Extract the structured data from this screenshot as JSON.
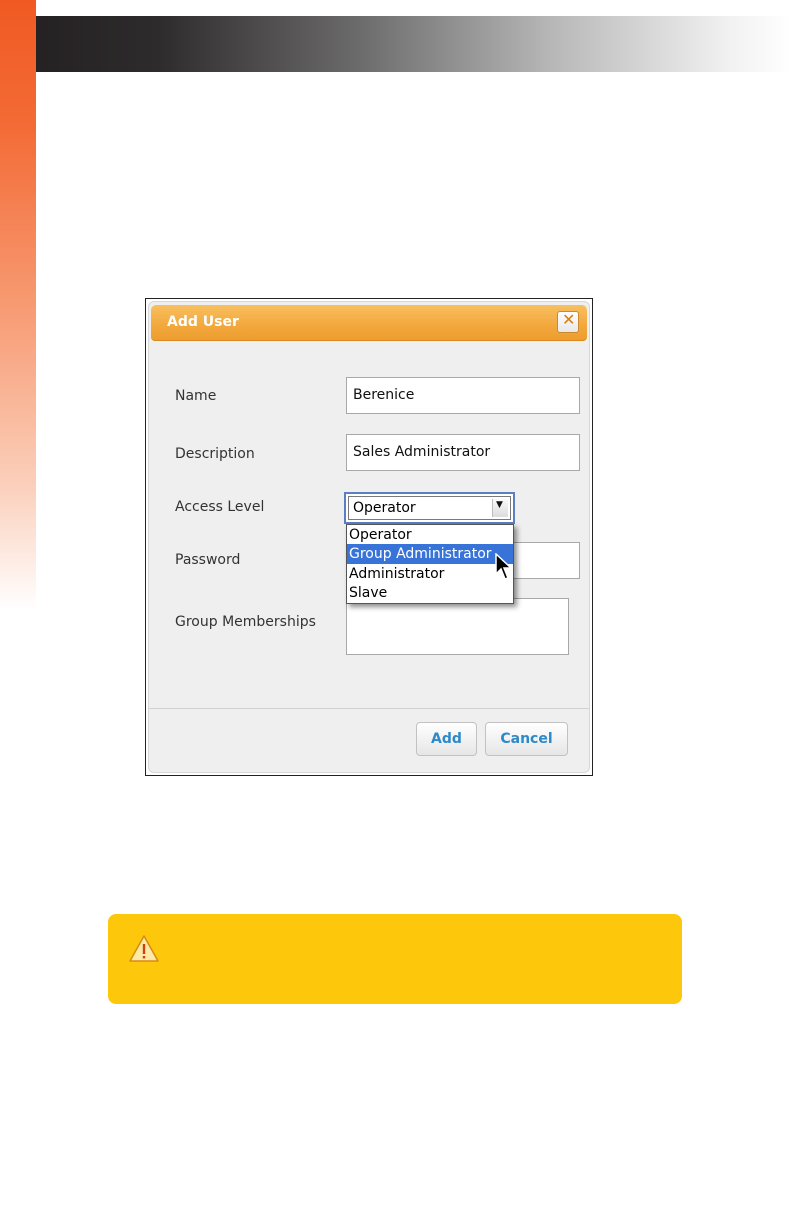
{
  "dialog": {
    "title": "Add User",
    "close_icon": "close-icon",
    "fields": {
      "name_label": "Name",
      "name_value": "Berenice",
      "description_label": "Description",
      "description_value": "Sales Administrator",
      "access_level_label": "Access Level",
      "access_level_value": "Operator",
      "password_label": "Password",
      "group_memberships_label": "Group Memberships"
    },
    "access_level_options": [
      {
        "label": "Operator",
        "highlighted": false
      },
      {
        "label": "Group Administrator",
        "highlighted": true
      },
      {
        "label": "Administrator",
        "highlighted": false
      },
      {
        "label": "Slave",
        "highlighted": false
      }
    ],
    "buttons": {
      "add": "Add",
      "cancel": "Cancel"
    }
  },
  "warning": {
    "icon": "warning-icon"
  },
  "colors": {
    "title_bar": "#f3a93f",
    "highlight": "#3874d8",
    "button_text": "#2e89c9",
    "warning_bg": "#fdc70c",
    "accent_orange": "#f05a22"
  }
}
